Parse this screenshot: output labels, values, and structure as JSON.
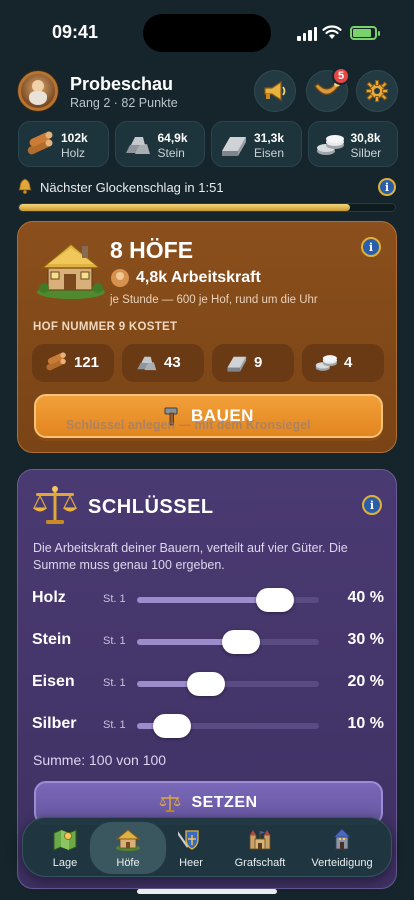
{
  "status_bar": {
    "time": "09:41"
  },
  "header": {
    "player_name": "Probeschau",
    "player_rank": "Rang 2 · 82 Punkte",
    "buttons": [
      {
        "name": "announcements",
        "icon": "megaphone-icon"
      },
      {
        "name": "horn",
        "icon": "horn-icon",
        "badge": "5"
      },
      {
        "name": "settings",
        "icon": "gear-icon"
      }
    ]
  },
  "resources": [
    {
      "value": "102k",
      "label": "Holz",
      "icon": "wood-icon"
    },
    {
      "value": "64,9k",
      "label": "Stein",
      "icon": "stone-icon"
    },
    {
      "value": "31,3k",
      "label": "Eisen",
      "icon": "iron-icon"
    },
    {
      "value": "30,8k",
      "label": "Silber",
      "icon": "silver-icon"
    }
  ],
  "bell": {
    "text": "Nächster Glockenschlag in 1:51",
    "progress": 0.88
  },
  "farms": {
    "title": "8 HÖFE",
    "workforce": "4,8k Arbeitskraft",
    "subtitle": "je Stunde — 600 je Hof, rund um die Uhr",
    "cost_label": "HOF NUMMER 9 KOSTET",
    "costs": [
      {
        "value": "121",
        "icon": "wood-icon"
      },
      {
        "value": "43",
        "icon": "stone-icon"
      },
      {
        "value": "9",
        "icon": "iron-icon"
      },
      {
        "value": "4",
        "icon": "silver-icon"
      }
    ],
    "build_label": "BAUEN"
  },
  "key": {
    "title": "SCHLÜSSEL",
    "description": "Die Arbeitskraft deiner Bauern, verteilt auf vier Güter. Die Summe muss genau 100 ergeben.",
    "sliders": [
      {
        "name": "Holz",
        "level": "St. 1",
        "pct_text": "40 %",
        "value": 40
      },
      {
        "name": "Stein",
        "level": "St. 1",
        "pct_text": "30 %",
        "value": 30
      },
      {
        "name": "Eisen",
        "level": "St. 1",
        "pct_text": "20 %",
        "value": 20
      },
      {
        "name": "Silber",
        "level": "St. 1",
        "pct_text": "10 %",
        "value": 10
      }
    ],
    "sum_text": "Summe: 100 von 100",
    "set_label": "SETZEN",
    "hint": "Schlüssel anlegen — mit dem Kronsiegel"
  },
  "tabs": [
    {
      "label": "Lage",
      "icon": "map-icon"
    },
    {
      "label": "Höfe",
      "icon": "farm-house-icon",
      "active": true
    },
    {
      "label": "Heer",
      "icon": "army-shield-icon"
    },
    {
      "label": "Grafschaft",
      "icon": "castle-icon"
    },
    {
      "label": "Verteidigung",
      "icon": "tower-icon"
    }
  ],
  "colors": {
    "background": "#15252b",
    "farm_card": "#7a4416",
    "key_card": "#3f3163",
    "accent_orange": "#e2851f",
    "accent_gold": "#e0b13a"
  }
}
